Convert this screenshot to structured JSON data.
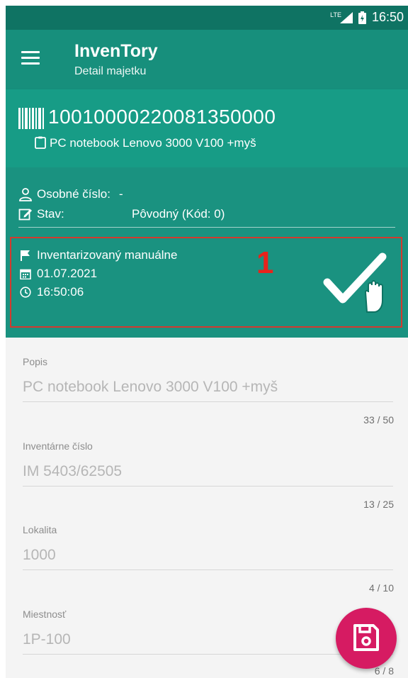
{
  "status_bar": {
    "network": "LTE",
    "time": "16:50"
  },
  "app_bar": {
    "title": "InvenTory",
    "subtitle": "Detail majetku"
  },
  "asset": {
    "barcode": "10010000220081350000",
    "name": "PC notebook Lenovo 3000 V100 +myš"
  },
  "info": {
    "personal_number_label": "Osobné číslo:",
    "personal_number_value": "-",
    "state_label": "Stav:",
    "state_value": "Pôvodný (Kód: 0)"
  },
  "inventory_status": {
    "text": "Inventarizovaný manuálne",
    "date": "01.07.2021",
    "time": "16:50:06",
    "marker": "1"
  },
  "form": {
    "fields": [
      {
        "label": "Popis",
        "value": "PC notebook Lenovo 3000 V100 +myš",
        "counter": "33 / 50"
      },
      {
        "label": "Inventárne číslo",
        "value": "IM 5403/62505",
        "counter": "13 / 25"
      },
      {
        "label": "Lokalita",
        "value": "1000",
        "counter": "4 / 10"
      },
      {
        "label": "Miestnosť",
        "value": "1P-100",
        "counter": "6 / 8"
      }
    ]
  },
  "colors": {
    "status_bar": "#0f7363",
    "app_bar": "#178f7c",
    "accent_fab": "#d61b62",
    "marker_red": "#e8231b"
  },
  "icons": {
    "menu": "hamburger-icon",
    "barcode": "barcode-icon",
    "save": "save-icon",
    "manual_check": "check-hand-icon"
  }
}
